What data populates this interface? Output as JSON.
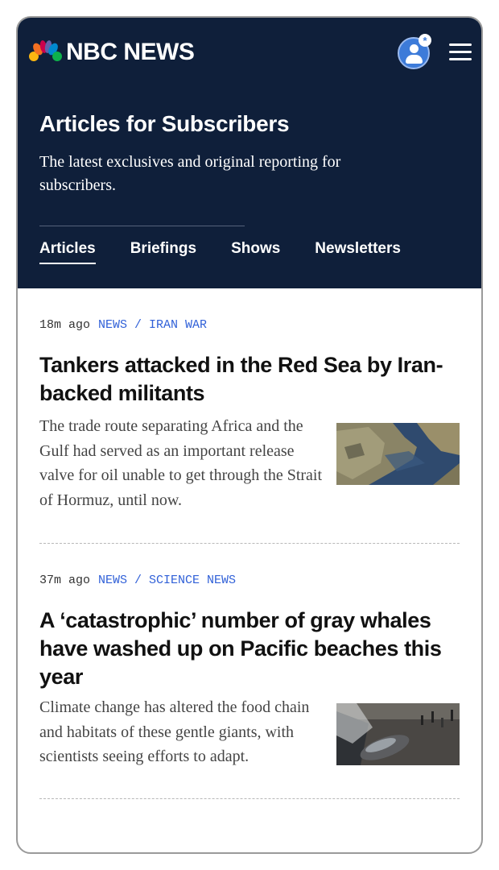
{
  "header": {
    "brand": "NBC NEWS",
    "account_badge": "*",
    "page_title": "Articles for Subscribers",
    "page_subtitle": "The latest exclusives and original reporting for subscribers.",
    "tabs": [
      {
        "label": "Articles",
        "active": true
      },
      {
        "label": "Briefings",
        "active": false
      },
      {
        "label": "Shows",
        "active": false
      },
      {
        "label": "Newsletters",
        "active": false
      }
    ]
  },
  "articles": [
    {
      "time": "18m ago",
      "category": "NEWS / IRAN WAR",
      "headline": "Tankers attacked in the Red Sea by Iran-backed militants",
      "dek": "The trade route separating Africa and the Gulf had served as an important release valve for oil unable to get through the Strait of Hormuz, until now.",
      "thumbnail": "satellite-image"
    },
    {
      "time": "37m ago",
      "category": "NEWS / SCIENCE NEWS",
      "headline": "A ‘catastrophic’ number of gray whales have washed up on Pacific beaches this year",
      "dek": "Climate change has altered the food chain and habitats of these gentle giants, with scientists seeing efforts to adapt.",
      "thumbnail": "beached-whale-photo"
    }
  ],
  "colors": {
    "header_bg": "#0f1f3a",
    "category_link": "#3161d8",
    "account_accent": "#3d7bd9"
  }
}
